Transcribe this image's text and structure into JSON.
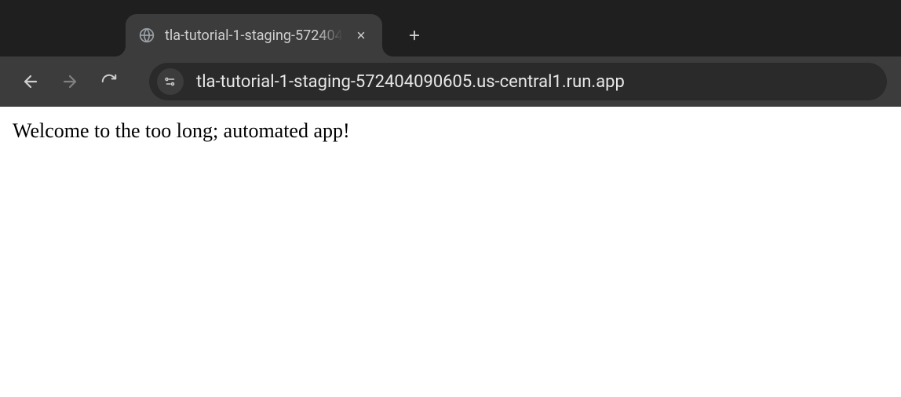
{
  "tab": {
    "title": "tla-tutorial-1-staging-572404"
  },
  "address_bar": {
    "url": "tla-tutorial-1-staging-572404090605.us-central1.run.app"
  },
  "page": {
    "body_text": "Welcome to the too long; automated app!"
  }
}
